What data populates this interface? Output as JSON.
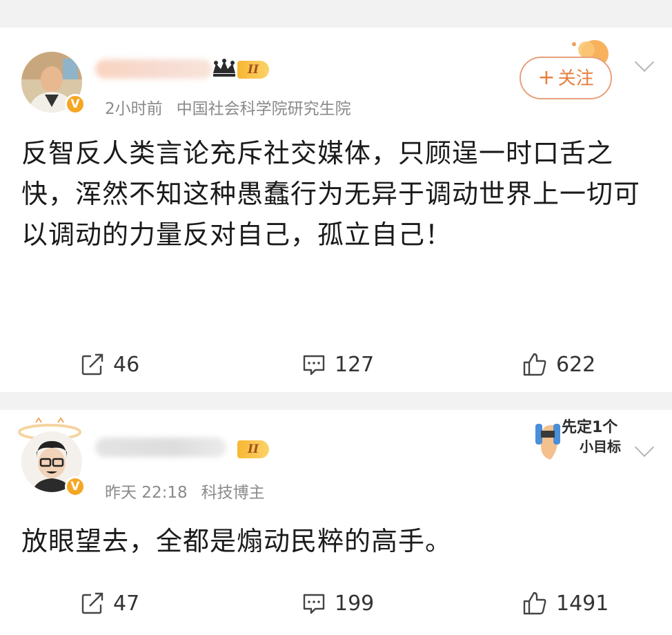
{
  "posts": [
    {
      "time": "2小时前",
      "source": "中国社会科学院研究生院",
      "level": "II",
      "verified_badge": "V",
      "follow_label": "关注",
      "follow_plus": "+",
      "text": "反智反人类言论充斥社交媒体，只顾逞一时口舌之快，浑然不知这种愚蠢行为无异于调动世界上一切可以调动的力量反对自己，孤立自己！",
      "reposts": "46",
      "comments": "127",
      "likes": "622"
    },
    {
      "time": "昨天 22:18",
      "source": "科技博主",
      "level": "II",
      "verified_badge": "V",
      "sticker_text_1": "先定1个",
      "sticker_text_2": "小目标",
      "text": "放眼望去，全都是煽动民粹的高手。",
      "reposts": "47",
      "comments": "199",
      "likes": "1491"
    }
  ],
  "icons": {
    "repost": "repost-icon",
    "comment": "comment-icon",
    "like": "thumbs-up-icon",
    "more": "chevron-down-icon"
  },
  "colors": {
    "accent": "#e67e3c",
    "badge": "#f5a623",
    "meta_text": "#8a8a8a",
    "background": "#f2f2f2"
  }
}
